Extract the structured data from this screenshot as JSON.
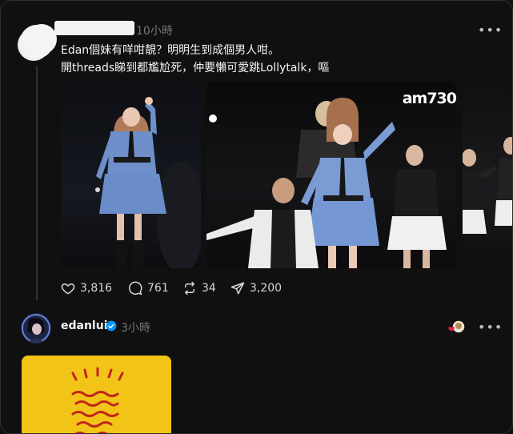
{
  "post1": {
    "timestamp": "10小時",
    "text_line1": "Edan個妹有咩咁靚？明明生到成個男人咁。",
    "text_line2": "開threads睇到都尷尬死，仲要懶可愛跳Lollytalk，嘔",
    "watermark": "am730",
    "stats": {
      "likes": "3,816",
      "comments": "761",
      "reposts": "34",
      "shares": "3,200"
    }
  },
  "post2": {
    "username": "edanlui",
    "timestamp": "3小時"
  },
  "colors": {
    "background": "#101010",
    "border": "#2e2e2e",
    "verified": "#0095f6",
    "yellow_card": "#f2c418",
    "card_marks": "#c2261c"
  },
  "icons": [
    "more-icon",
    "heart-icon",
    "comment-icon",
    "repost-icon",
    "share-icon",
    "verified-icon",
    "heart-emoji-icon"
  ]
}
